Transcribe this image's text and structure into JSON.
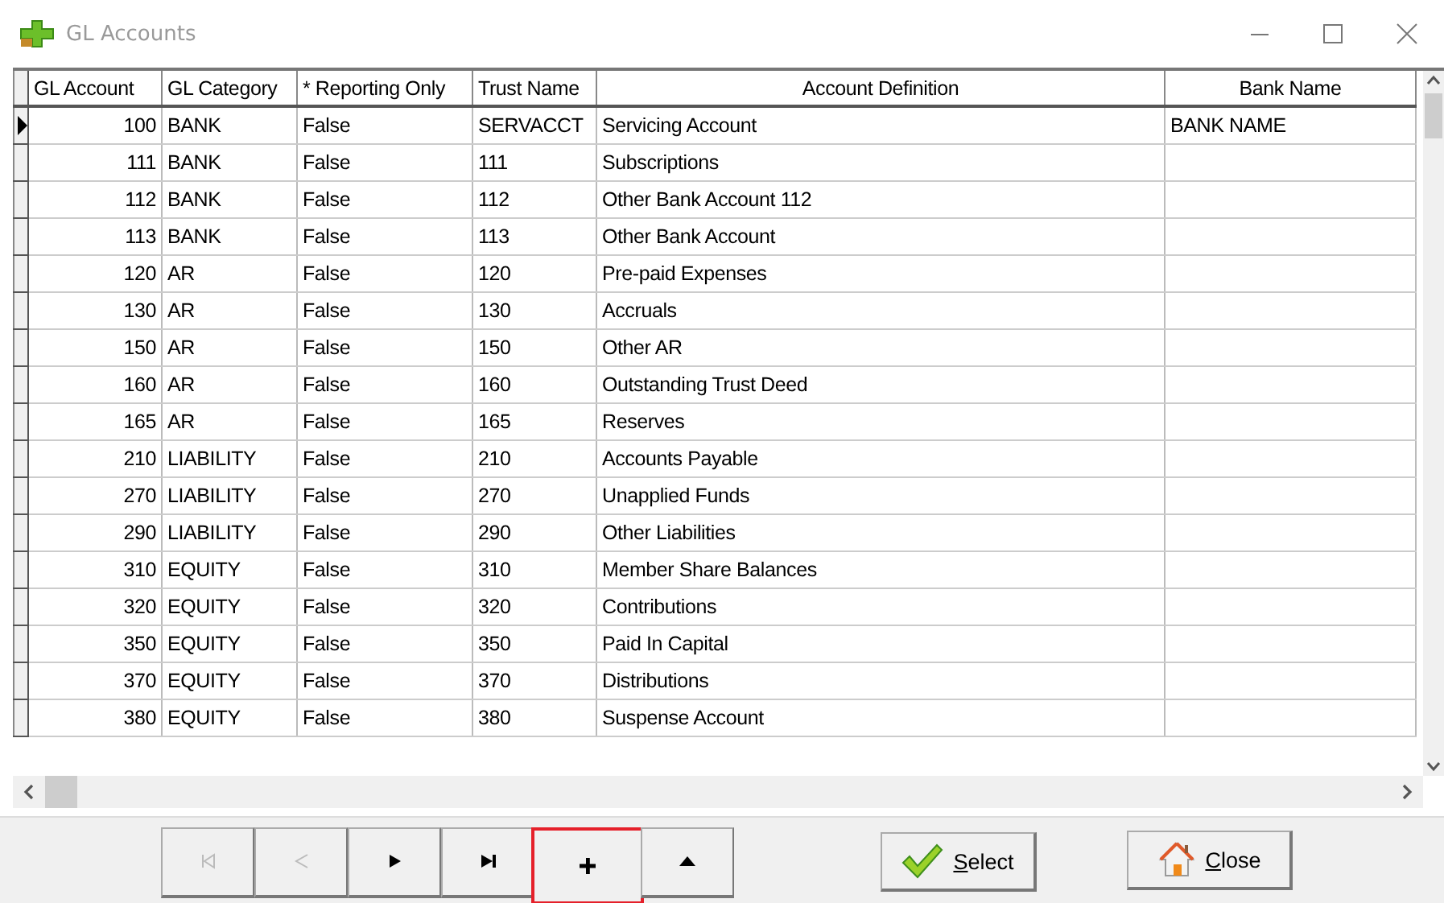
{
  "window": {
    "title": "GL Accounts"
  },
  "table": {
    "columns": [
      "GL Account",
      "GL Category",
      "* Reporting Only",
      "Trust Name",
      "Account Definition",
      "Bank Name"
    ],
    "rows": [
      {
        "selected": true,
        "cells": [
          "100",
          "BANK",
          "False",
          "SERVACCT",
          "Servicing Account",
          "BANK NAME"
        ]
      },
      {
        "selected": false,
        "cells": [
          "111",
          "BANK",
          "False",
          "111",
          "Subscriptions",
          ""
        ]
      },
      {
        "selected": false,
        "cells": [
          "112",
          "BANK",
          "False",
          "112",
          "Other Bank Account 112",
          ""
        ]
      },
      {
        "selected": false,
        "cells": [
          "113",
          "BANK",
          "False",
          "113",
          "Other Bank Account",
          ""
        ]
      },
      {
        "selected": false,
        "cells": [
          "120",
          "AR",
          "False",
          "120",
          "Pre-paid Expenses",
          ""
        ]
      },
      {
        "selected": false,
        "cells": [
          "130",
          "AR",
          "False",
          "130",
          "Accruals",
          ""
        ]
      },
      {
        "selected": false,
        "cells": [
          "150",
          "AR",
          "False",
          "150",
          "Other AR",
          ""
        ]
      },
      {
        "selected": false,
        "cells": [
          "160",
          "AR",
          "False",
          "160",
          "Outstanding Trust Deed",
          ""
        ]
      },
      {
        "selected": false,
        "cells": [
          "165",
          "AR",
          "False",
          "165",
          "Reserves",
          ""
        ]
      },
      {
        "selected": false,
        "cells": [
          "210",
          "LIABILITY",
          "False",
          "210",
          "Accounts Payable",
          ""
        ]
      },
      {
        "selected": false,
        "cells": [
          "270",
          "LIABILITY",
          "False",
          "270",
          "Unapplied Funds",
          ""
        ]
      },
      {
        "selected": false,
        "cells": [
          "290",
          "LIABILITY",
          "False",
          "290",
          "Other Liabilities",
          ""
        ]
      },
      {
        "selected": false,
        "cells": [
          "310",
          "EQUITY",
          "False",
          "310",
          "Member Share Balances",
          ""
        ]
      },
      {
        "selected": false,
        "cells": [
          "320",
          "EQUITY",
          "False",
          "320",
          "Contributions",
          ""
        ]
      },
      {
        "selected": false,
        "cells": [
          "350",
          "EQUITY",
          "False",
          "350",
          "Paid In Capital",
          ""
        ]
      },
      {
        "selected": false,
        "cells": [
          "370",
          "EQUITY",
          "False",
          "370",
          "Distributions",
          ""
        ]
      },
      {
        "selected": false,
        "cells": [
          "380",
          "EQUITY",
          "False",
          "380",
          "Suspense Account",
          ""
        ]
      }
    ]
  },
  "navigator": [
    {
      "kind": "first",
      "disabled": true,
      "highlighted": false
    },
    {
      "kind": "prior",
      "disabled": true,
      "highlighted": false
    },
    {
      "kind": "next",
      "disabled": false,
      "highlighted": false
    },
    {
      "kind": "last",
      "disabled": false,
      "highlighted": false
    },
    {
      "kind": "insert",
      "disabled": false,
      "highlighted": true
    },
    {
      "kind": "up",
      "disabled": false,
      "highlighted": false
    }
  ],
  "buttons": [
    {
      "kind": "select",
      "label": "Select"
    },
    {
      "kind": "close",
      "label": "Close"
    }
  ]
}
